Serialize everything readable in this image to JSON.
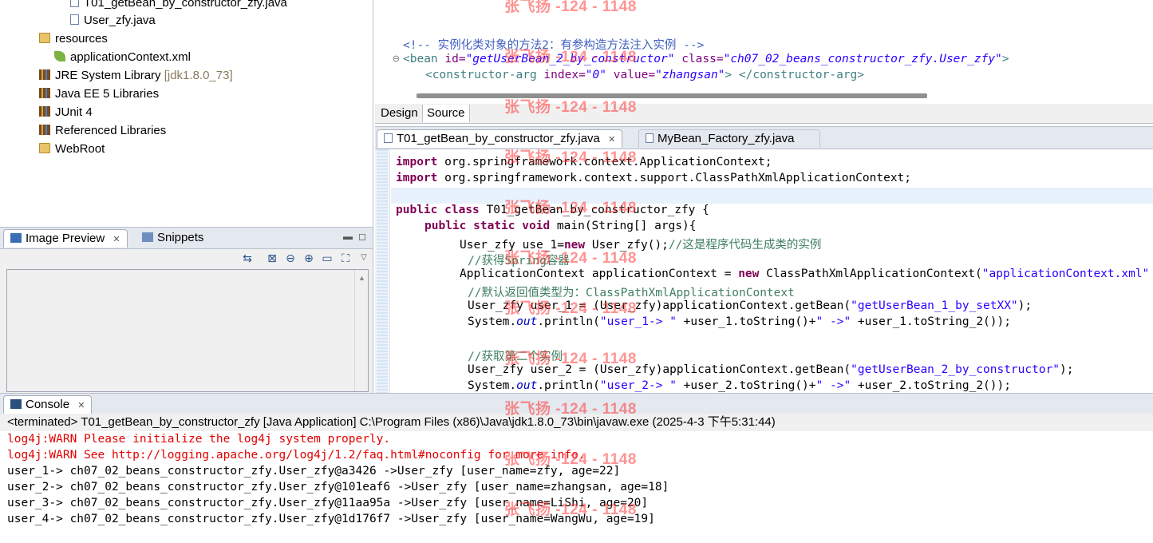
{
  "tree": {
    "items": [
      {
        "label": "T01_getBean_by_constructor_zfy.java"
      },
      {
        "label": "User_zfy.java"
      },
      {
        "label": "resources"
      },
      {
        "label": "applicationContext.xml"
      },
      {
        "label": "JRE System Library",
        "suffix": "[jdk1.8.0_73]"
      },
      {
        "label": "Java EE 5 Libraries"
      },
      {
        "label": "JUnit 4"
      },
      {
        "label": "Referenced Libraries"
      },
      {
        "label": "WebRoot"
      }
    ]
  },
  "preview": {
    "tabs": [
      {
        "label": "Image Preview"
      },
      {
        "label": "Snippets"
      }
    ]
  },
  "xml_editor": {
    "comment": "<!-- 实例化类对象的方法2：有参构造方法注入实例 -->",
    "bean_tag": "<bean",
    "bean_id_attr": " id=",
    "bean_id_val": "\"getUserBean_2_by_constructor\"",
    "bean_class_attr": " class=",
    "bean_class_val": "\"ch07_02_beans_constructor_zfy.User_zfy\"",
    "bean_close": ">",
    "carg_open": "<constructor-arg",
    "carg_index_attr": " index=",
    "carg_index_val": "\"0\"",
    "carg_value_attr": " value=",
    "carg_value_val": "\"zhangsan\"",
    "carg_close": "> </constructor-arg>",
    "tabs": {
      "design": "Design",
      "source": "Source"
    }
  },
  "java_editor": {
    "tabs": [
      {
        "label": "T01_getBean_by_constructor_zfy.java"
      },
      {
        "label": "MyBean_Factory_zfy.java"
      }
    ],
    "kw_import": "import",
    "kw_public": "public",
    "kw_class": "class",
    "kw_static": "static",
    "kw_void": "void",
    "kw_new": "new",
    "import1": " org.springframework.context.ApplicationContext;",
    "import2": " org.springframework.context.support.ClassPathXmlApplicationContext;",
    "class_decl": " T01_getBean_by_constructor_zfy {",
    "main_decl": " main(String[] args){",
    "l1a": "User_zfy use_1=",
    "l1b": " User_zfy();",
    "l1c": "//这是程序代码生成类的实例",
    "l2": "//获得Spring容器",
    "l3a": "ApplicationContext applicationContext = ",
    "l3b": " ClassPathXmlApplicationContext(",
    "l3c": "\"applicationContext.xml\"",
    "l4": "//默认返回值类型为：ClassPathXmlApplicationContext",
    "l5a": "User_zfy user_1 = (User_zfy)applicationContext.getBean(",
    "l5b": "\"getUserBean_1_by_setXX\"",
    "l5c": ");",
    "l6a": "System.",
    "l6out": "out",
    "l6b": ".println(",
    "l6c": "\"user_1-> \"",
    "l6d": " +user_1.toString()+",
    "l6e": "\" ->\"",
    "l6f": " +user_1.toString_2());",
    "l7": "//获取第二个实例",
    "l8a": "User_zfy user_2 = (User_zfy)applicationContext.getBean(",
    "l8b": "\"getUserBean_2_by_constructor\"",
    "l8c": ");",
    "l9c": "\"user_2-> \"",
    "l9d": " +user_2.toString()+",
    "l9e": "\" ->\"",
    "l9f": " +user_2.toString_2());"
  },
  "console": {
    "tab": "Console",
    "status": "<terminated> T01_getBean_by_constructor_zfy [Java Application] C:\\Program Files (x86)\\Java\\jdk1.8.0_73\\bin\\javaw.exe (2025-4-3 下午5:31:44)",
    "warn": [
      "log4j:WARN Please initialize the log4j system properly.",
      "log4j:WARN See http://logging.apache.org/log4j/1.2/faq.html#noconfig for more info."
    ],
    "lines": [
      "user_1-> ch07_02_beans_constructor_zfy.User_zfy@a3426 ->User_zfy [user_name=zfy, age=22]",
      "user_2-> ch07_02_beans_constructor_zfy.User_zfy@101eaf6 ->User_zfy [user_name=zhangsan, age=18]",
      "user_3-> ch07_02_beans_constructor_zfy.User_zfy@11aa95a ->User_zfy [user_name=LiShi, age=20]",
      "user_4-> ch07_02_beans_constructor_zfy.User_zfy@1d176f7 ->User_zfy [user_name=WangWu, age=19]"
    ]
  },
  "watermark": "张飞扬 -124 - 1148",
  "colors": {
    "keyword": "#7f0055",
    "string": "#2a00ff",
    "comment": "#3f7f5f",
    "warn": "#e30000"
  }
}
